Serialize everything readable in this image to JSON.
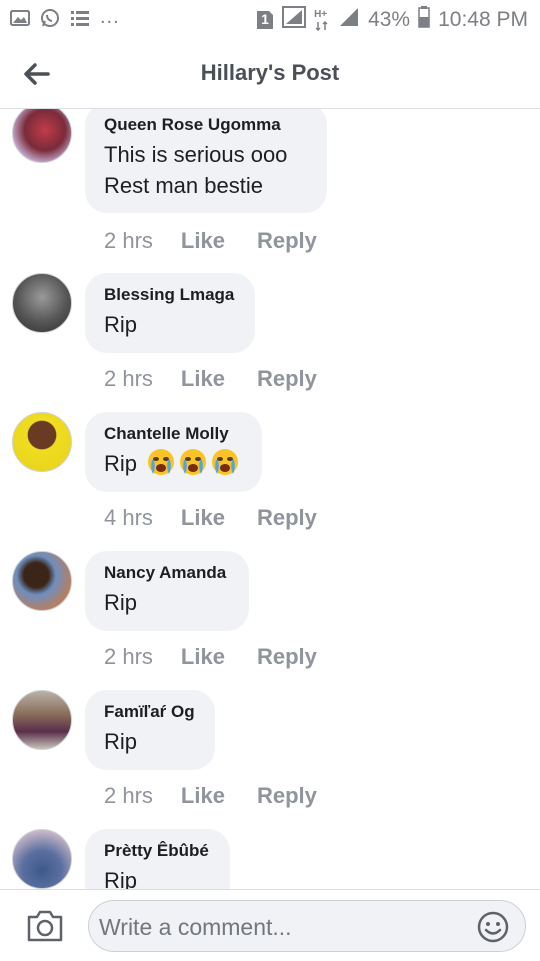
{
  "status_bar": {
    "battery": "43%",
    "time": "10:48 PM",
    "sim_badge": "1",
    "network_badge": "H+",
    "overflow": "...",
    "icons": [
      "gallery-icon",
      "whatsapp-icon",
      "list-icon",
      "sim-icon",
      "signal-icon",
      "hplus-icon",
      "battery-icon"
    ]
  },
  "header": {
    "title": "Hillary's Post",
    "back_icon": "back-arrow-icon"
  },
  "comments": [
    {
      "name": "Queen Rose Ugomma",
      "lines": [
        "This is serious ooo",
        "Rest man bestie"
      ],
      "time": "2 hrs",
      "like": "Like",
      "reply": "Reply",
      "avatar_color": "#7a2b3a"
    },
    {
      "name": "Blessing Lmaga",
      "lines": [
        "Rip"
      ],
      "time": "2 hrs",
      "like": "Like",
      "reply": "Reply",
      "avatar_color": "#6f6f6f"
    },
    {
      "name": "Chantelle Molly",
      "lines": [
        "Rip"
      ],
      "emojis": [
        "crying-face-emoji",
        "crying-face-emoji",
        "crying-face-emoji"
      ],
      "time": "4 hrs",
      "like": "Like",
      "reply": "Reply",
      "avatar_color": "#e6d21a"
    },
    {
      "name": "Nancy Amanda",
      "lines": [
        "Rip"
      ],
      "time": "2 hrs",
      "like": "Like",
      "reply": "Reply",
      "avatar_color": "#4a6e9a"
    },
    {
      "name": "Famïľaŕ Og",
      "lines": [
        "Rip"
      ],
      "time": "2 hrs",
      "like": "Like",
      "reply": "Reply",
      "avatar_color": "#8a6d5a"
    },
    {
      "name": "Prètty Êbûbé",
      "lines": [
        "Rip"
      ],
      "time": "",
      "like": "",
      "reply": "",
      "avatar_color": "#5b6fa0"
    }
  ],
  "composer": {
    "placeholder": "Write a comment...",
    "camera_icon": "camera-icon",
    "emoji_icon": "smiley-icon"
  },
  "colors": {
    "bubble": "#f1f2f6",
    "meta_text": "#90949c",
    "title_text": "#4b4f56",
    "divider": "#dadde1"
  }
}
